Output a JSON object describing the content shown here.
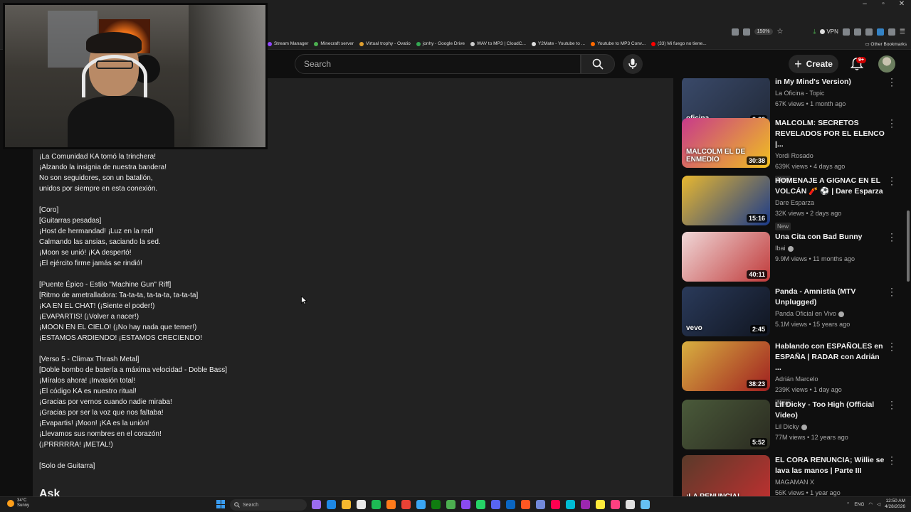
{
  "browser": {
    "zoom": "150%",
    "vpn_label": "VPN",
    "bookmarks": [
      {
        "label": "Stream Manager",
        "color": "#9146ff"
      },
      {
        "label": "Minecraft server",
        "color": "#4caf50"
      },
      {
        "label": "Virtual trophy - Ovatio",
        "color": "#e0a030"
      },
      {
        "label": "jonhy - Google Drive",
        "color": "#34a853"
      },
      {
        "label": "WAV to MP3 | CloudC...",
        "color": "#cccccc"
      },
      {
        "label": "Y2Mate - Youtube to ...",
        "color": "#dddddd"
      },
      {
        "label": "Youtube to MP3 Conv...",
        "color": "#ff6a00"
      },
      {
        "label": "(33) Mi fuego no tiene...",
        "color": "#ff0000"
      }
    ],
    "other_bookmarks": "Other Bookmarks"
  },
  "header": {
    "search_placeholder": "Search",
    "create_label": "Create",
    "notifications": "9+"
  },
  "description": {
    "lyrics": "¡La Comunidad KA tomó la trinchera!\n¡Alzando la insignia de nuestra bandera!\nNo son seguidores, son un batallón,\nunidos por siempre en esta conexión.\n\n[Coro]\n[Guitarras pesadas]\n¡Host de hermandad! ¡Luz en la red!\nCalmando las ansias, saciando la sed.\n¡Moon se unió! ¡KA despertó!\n¡El ejército firme jamás se rindió!\n\n[Puente Épico - Estilo \"Machine Gun\" Riff]\n[Ritmo de ametralladora: Ta-ta-ta, ta-ta-ta, ta-ta-ta]\n¡KA EN EL CHAT! (¡Siente el poder!)\n¡EVAPARTIS! (¡Volver a nacer!)\n¡MOON EN EL CIELO! (¡No hay nada que temer!)\n¡ESTAMOS ARDIENDO! ¡ESTAMOS CRECIENDO!\n\n[Verso 5 - Clímax Thrash Metal]\n[Doble bombo de batería a máxima velocidad - Doble Bass]\n¡Míralos ahora! ¡Invasión total!\n¡El código KA es nuestro ritual!\n¡Gracias por vernos cuando nadie miraba!\n¡Gracias por ser la voz que nos faltaba!\n¡Evapartis! ¡Moon! ¡KA es la unión!\n¡Llevamos sus nombres en el corazón!\n(¡PRRRRRA! ¡METAL!)\n\n[Solo de Guitarra]",
    "ask_heading": "Ask"
  },
  "sidebar": {
    "videos": [
      {
        "title": "in My Mind's Version)",
        "channel": "La Oficina - Topic",
        "meta": "67K views • 1 month ago",
        "duration": "3:22",
        "badge": "",
        "thumb_label": "oficina",
        "thumb_colors": [
          "#3a4a6a",
          "#222a3a"
        ],
        "verified": false
      },
      {
        "title": "MALCOLM: SECRETOS REVELADOS POR EL ELENCO |...",
        "channel": "Yordi Rosado",
        "meta": "639K views • 4 days ago",
        "duration": "30:38",
        "badge": "New",
        "thumb_label": "MALCOLM EL DE ENMEDIO",
        "thumb_colors": [
          "#c83a8a",
          "#f0c020"
        ],
        "verified": false
      },
      {
        "title": "HOMENAJE A GIGNAC EN EL VOLCÁN 🧨 ⚽ | Dare Esparza",
        "channel": "Dare Esparza",
        "meta": "32K views • 2 days ago",
        "duration": "15:16",
        "badge": "New",
        "thumb_label": "",
        "thumb_colors": [
          "#e8b830",
          "#1a3a8a"
        ],
        "verified": false
      },
      {
        "title": "Una Cita con Bad Bunny",
        "channel": "Ibai",
        "meta": "9.9M views • 11 months ago",
        "duration": "40:11",
        "badge": "",
        "thumb_label": "",
        "thumb_colors": [
          "#f0d8d8",
          "#c03a3a"
        ],
        "verified": true
      },
      {
        "title": "Panda - Amnistía (MTV Unplugged)",
        "channel": "Panda Oficial en Vivo",
        "meta": "5.1M views • 15 years ago",
        "duration": "2:45",
        "badge": "",
        "thumb_label": "vevo",
        "thumb_colors": [
          "#2a3a5a",
          "#101520"
        ],
        "verified": true
      },
      {
        "title": "Hablando con ESPAÑOLES en ESPAÑA | RADAR con Adrián ...",
        "channel": "Adrián Marcelo",
        "meta": "239K views • 1 day ago",
        "duration": "38:23",
        "badge": "New",
        "thumb_label": "",
        "thumb_colors": [
          "#d8b040",
          "#a02020"
        ],
        "verified": false
      },
      {
        "title": "Lil Dicky - Too High (Official Video)",
        "channel": "Lil Dicky",
        "meta": "77M views • 12 years ago",
        "duration": "5:52",
        "badge": "",
        "thumb_label": "",
        "thumb_colors": [
          "#4a5a3a",
          "#2a2a20"
        ],
        "verified": true
      },
      {
        "title": "EL CORA RENUNCIA; Willie se lava las manos | Parte III",
        "channel": "MAGAMAN X",
        "meta": "56K views • 1 year ago",
        "duration": "",
        "badge": "",
        "thumb_label": "¡LA RENUNCIA!",
        "thumb_colors": [
          "#5a3a2a",
          "#c03030"
        ],
        "verified": false
      }
    ]
  },
  "taskbar": {
    "weather_temp": "34°C",
    "weather_desc": "Sunny",
    "search_placeholder": "Search",
    "lang": "ENG",
    "time": "12:50 AM",
    "date": "4/28/2026"
  }
}
